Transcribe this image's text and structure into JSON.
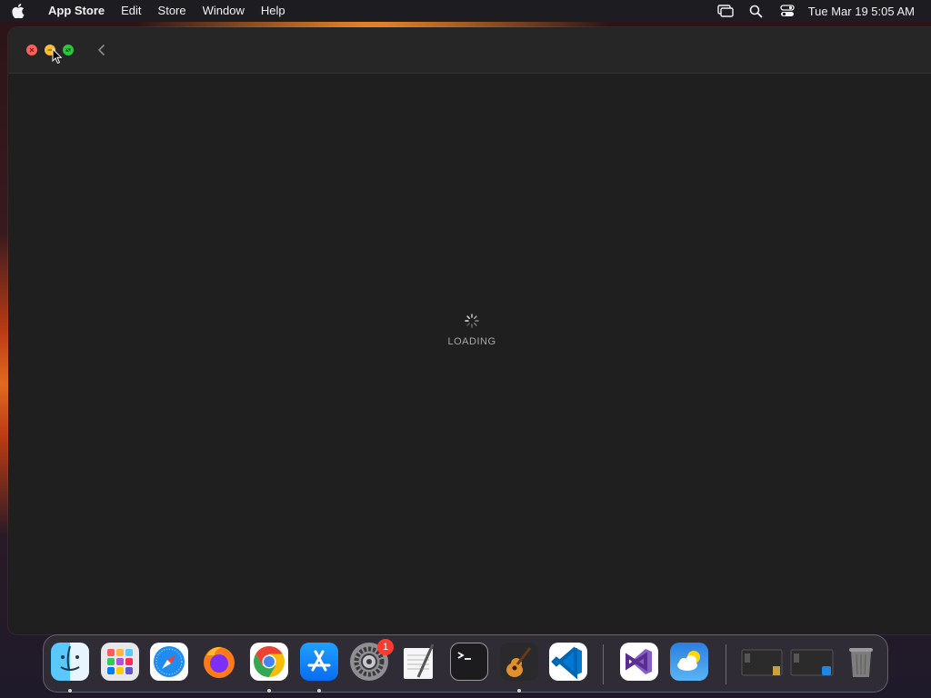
{
  "menubar": {
    "apple_icon": "apple-logo-icon",
    "app_name": "App Store",
    "menus": [
      "Edit",
      "Store",
      "Window",
      "Help"
    ],
    "status_icons": [
      "screen-mirroring-icon",
      "spotlight-search-icon",
      "control-center-icon"
    ],
    "clock": "Tue Mar 19  5:05 AM"
  },
  "window": {
    "title_controls": [
      "close",
      "minimize",
      "zoom"
    ],
    "back_icon": "chevron-left-icon",
    "loading_text": "LOADING"
  },
  "dock": {
    "apps": [
      {
        "name": "Finder",
        "icon": "finder-icon",
        "running": true
      },
      {
        "name": "Launchpad",
        "icon": "launchpad-icon",
        "running": false
      },
      {
        "name": "Safari",
        "icon": "safari-icon",
        "running": false
      },
      {
        "name": "Firefox",
        "icon": "firefox-icon",
        "running": false
      },
      {
        "name": "Google Chrome",
        "icon": "chrome-icon",
        "running": true
      },
      {
        "name": "App Store",
        "icon": "app-store-icon",
        "running": true
      },
      {
        "name": "System Settings",
        "icon": "system-settings-icon",
        "running": false,
        "badge": "1"
      },
      {
        "name": "TextEdit",
        "icon": "textedit-icon",
        "running": false
      },
      {
        "name": "Terminal",
        "icon": "terminal-icon",
        "running": false
      },
      {
        "name": "GarageBand",
        "icon": "garageband-icon",
        "running": true
      },
      {
        "name": "Visual Studio Code",
        "icon": "vscode-icon",
        "running": false
      },
      {
        "name": "Visual Studio",
        "icon": "visual-studio-icon",
        "running": false
      },
      {
        "name": "Weather",
        "icon": "weather-icon",
        "running": false
      },
      {
        "name": "Minimized Window 1",
        "icon": "minimized-window-icon",
        "running": false
      },
      {
        "name": "Minimized Window 2",
        "icon": "minimized-window-icon",
        "running": false
      },
      {
        "name": "Trash",
        "icon": "trash-icon",
        "running": false
      }
    ]
  },
  "colors": {
    "close": "#ff5f57",
    "minimize": "#febc2e",
    "zoom": "#28c840",
    "window_bg": "#1f1f1f",
    "badge": "#ff3b30"
  }
}
